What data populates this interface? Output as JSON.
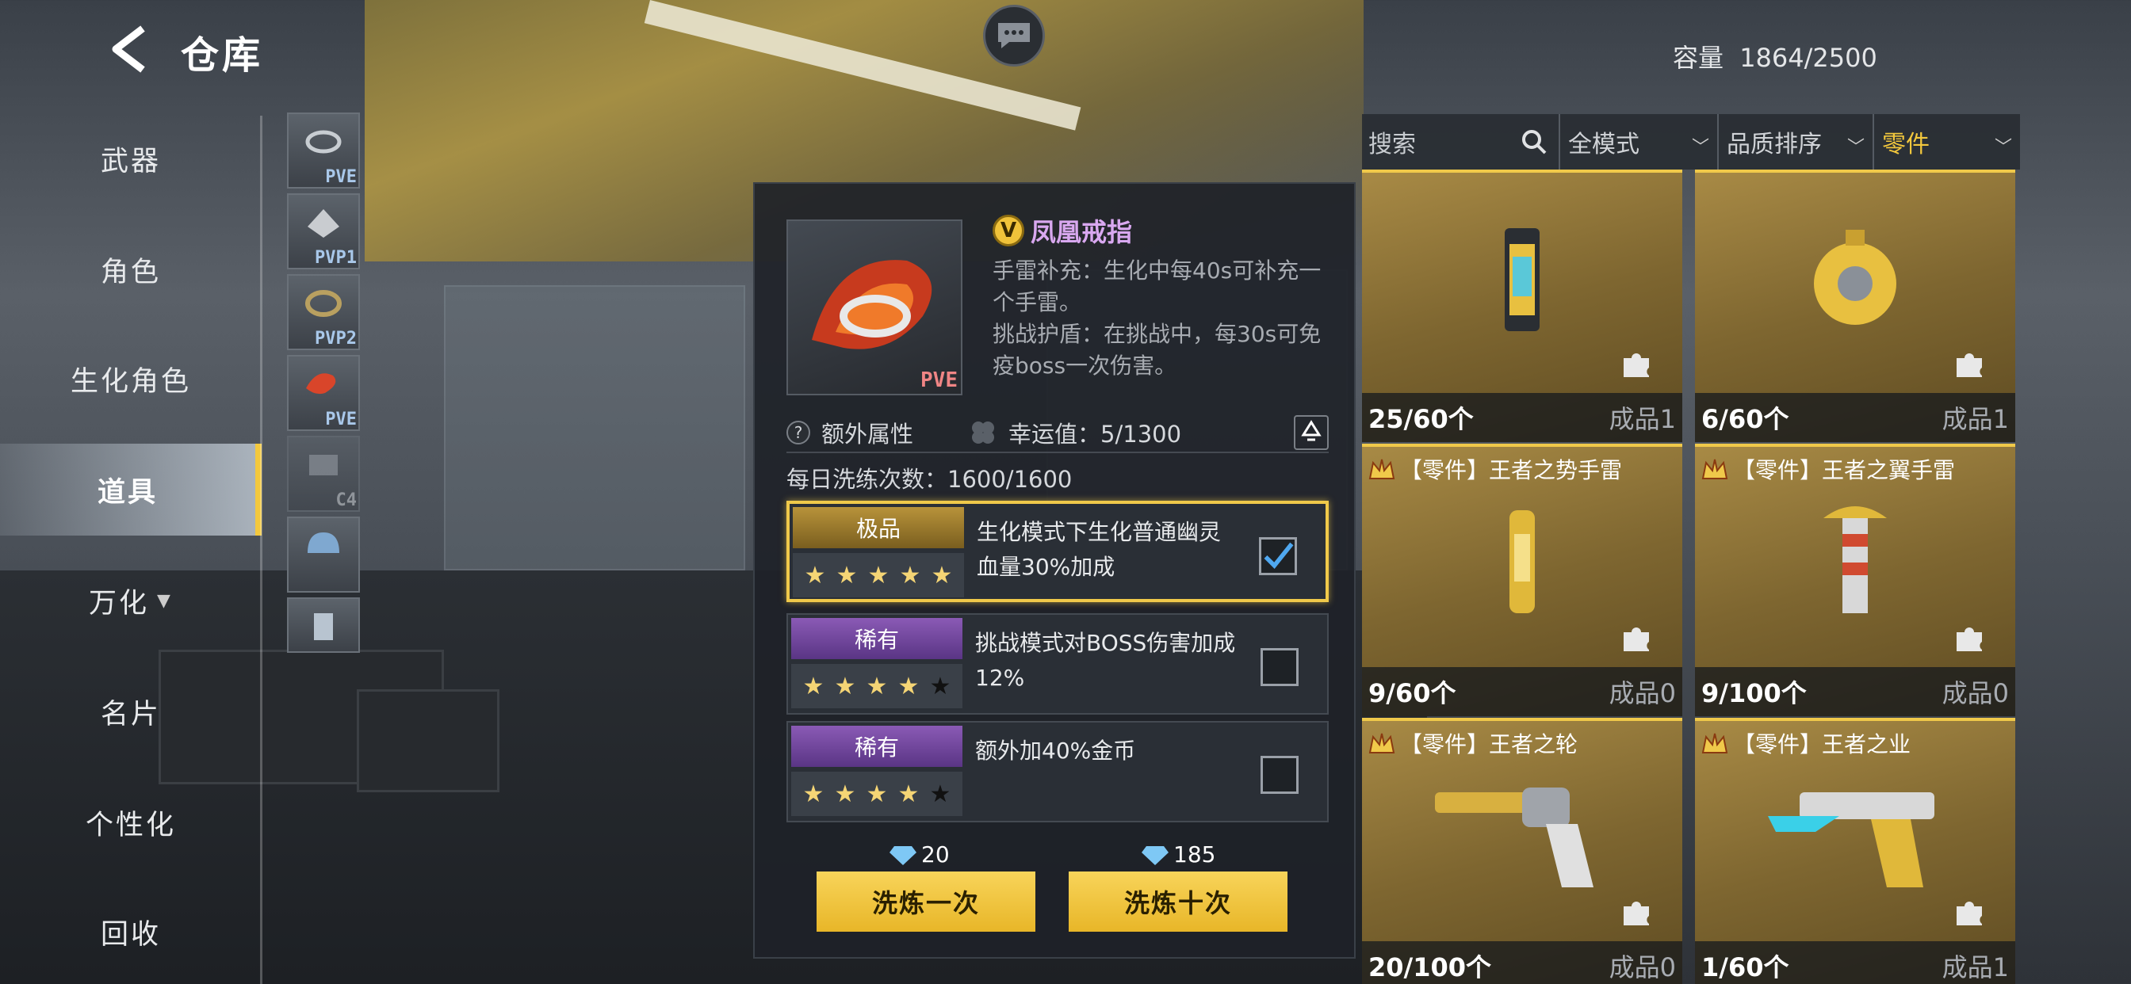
{
  "header": {
    "title": "仓库",
    "capacity_label": "容量",
    "capacity_value": "1864/2500"
  },
  "nav": {
    "items": [
      {
        "label": "武器"
      },
      {
        "label": "角色"
      },
      {
        "label": "生化角色"
      },
      {
        "label": "道具",
        "active": true
      },
      {
        "label": "万化"
      },
      {
        "label": "名片"
      },
      {
        "label": "个性化"
      },
      {
        "label": "回收"
      }
    ]
  },
  "thumbnails": [
    {
      "tag": "PVE"
    },
    {
      "tag": "PVP1"
    },
    {
      "tag": "PVP2"
    },
    {
      "tag": "PVE"
    },
    {
      "tag": "C4"
    },
    {
      "tag": ""
    },
    {
      "tag": ""
    }
  ],
  "detail": {
    "badge": "V",
    "name": "凤凰戒指",
    "mode_tag": "PVE",
    "description": [
      "手雷补充：生化中每40s可补充一个手雷。",
      "挑战护盾：在挑战中，每30s可免疫boss一次伤害。"
    ],
    "extra_label": "额外属性",
    "luck_label": "幸运值：5/1300",
    "daily_label": "每日洗练次数：1600/1600",
    "options": [
      {
        "grade": "极品",
        "stars_on": 5,
        "stars_total": 5,
        "text": "生化模式下生化普通幽灵血量30%加成",
        "checked": true
      },
      {
        "grade": "稀有",
        "stars_on": 4,
        "stars_total": 5,
        "text": "挑战模式对BOSS伤害加成12%",
        "checked": false
      },
      {
        "grade": "稀有",
        "stars_on": 4,
        "stars_total": 5,
        "text": "额外加40%金币",
        "checked": false
      }
    ],
    "price_once": "20",
    "price_ten": "185",
    "btn_once": "洗炼一次",
    "btn_ten": "洗炼十次"
  },
  "filters": {
    "search_placeholder": "搜索",
    "mode": "全模式",
    "sort": "品质排序",
    "category": "零件"
  },
  "cards": [
    {
      "name": "",
      "count": "25/60个",
      "done": "成品1"
    },
    {
      "name": "",
      "count": "6/60个",
      "done": "成品1"
    },
    {
      "name": "【零件】王者之势手雷",
      "count": "9/60个",
      "done": "成品0"
    },
    {
      "name": "【零件】王者之翼手雷",
      "count": "9/100个",
      "done": "成品0"
    },
    {
      "name": "【零件】王者之轮",
      "count": "20/100个",
      "done": "成品0"
    },
    {
      "name": "【零件】王者之业",
      "count": "1/60个",
      "done": "成品1"
    }
  ],
  "colors": {
    "accent_gold": "#f0c94a",
    "grade_gold": "#b8933a",
    "grade_purple": "#8a5ab5",
    "item_name": "#d9a8f0"
  }
}
